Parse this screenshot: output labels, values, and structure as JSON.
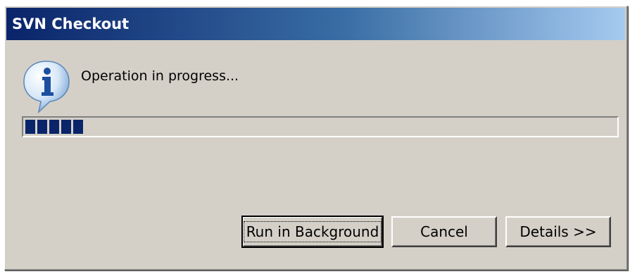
{
  "window": {
    "title": "SVN Checkout"
  },
  "message": {
    "text": "Operation in progress...",
    "icon": "information-icon"
  },
  "progress": {
    "value_percent": 10,
    "color": "#0a246a"
  },
  "buttons": {
    "run_in_background": "Run in Background",
    "cancel": "Cancel",
    "details": "Details >>"
  },
  "colors": {
    "titlebar_start": "#0a246a",
    "titlebar_end": "#a6caf0",
    "dialog_bg": "#d4d0c8"
  }
}
